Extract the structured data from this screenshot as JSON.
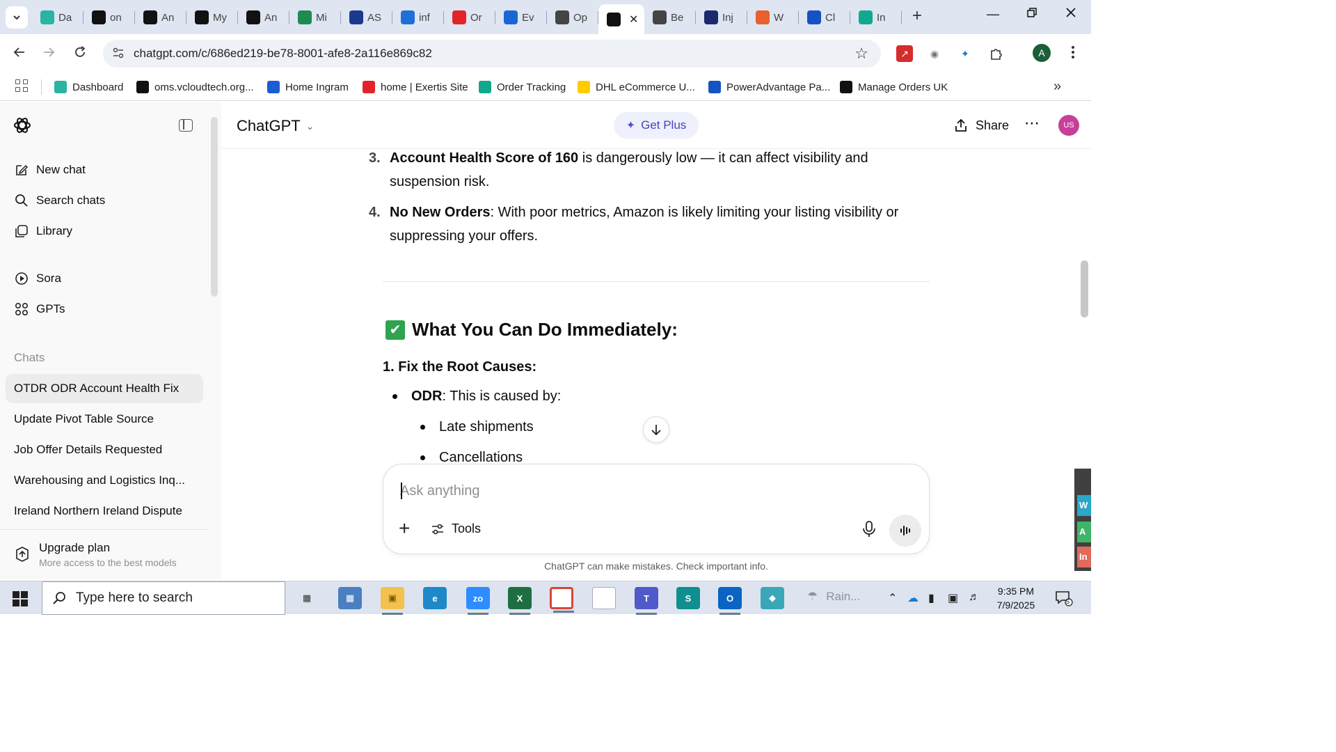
{
  "browser": {
    "tabs": [
      {
        "label": "Da",
        "fav_color": "#2bb3a4",
        "fav_icon": "dashboard-icon"
      },
      {
        "label": "on",
        "fav_color": "#111111",
        "fav_icon": "triangle-icon"
      },
      {
        "label": "An",
        "fav_color": "#111111",
        "fav_icon": "amazon-icon"
      },
      {
        "label": "My",
        "fav_color": "#111111",
        "fav_icon": "amazon-icon"
      },
      {
        "label": "An",
        "fav_color": "#111111",
        "fav_icon": "amazon-icon"
      },
      {
        "label": "Mi",
        "fav_color": "#1f8a52",
        "fav_icon": "leaf-icon"
      },
      {
        "label": "AS",
        "fav_color": "#1a3a8c",
        "fav_icon": "arrow-icon"
      },
      {
        "label": "inf",
        "fav_color": "#1e6fd9",
        "fav_icon": "infinity-icon"
      },
      {
        "label": "Or",
        "fav_color": "#e0242a",
        "fav_icon": "exertis-icon"
      },
      {
        "label": "Ev",
        "fav_color": "#1967d2",
        "fav_icon": "e-icon"
      },
      {
        "label": "Op",
        "fav_color": "#444444",
        "fav_icon": "openai-icon"
      },
      {
        "label": "",
        "fav_color": "#111111",
        "fav_icon": "openai-icon",
        "active": true
      },
      {
        "label": "Be",
        "fav_color": "#444444",
        "fav_icon": "bulb-icon"
      },
      {
        "label": "Inj",
        "fav_color": "#1a2a6c",
        "fav_icon": "ku-icon"
      },
      {
        "label": "W",
        "fav_color": "#e8602c",
        "fav_icon": "w-icon"
      },
      {
        "label": "Cl",
        "fav_color": "#1552c4",
        "fav_icon": "etn-icon"
      },
      {
        "label": "In",
        "fav_color": "#12a88f",
        "fav_icon": "c-icon"
      }
    ],
    "address": "chatgpt.com/c/686ed219-be78-8001-afe8-2a116e869c82",
    "profile_initial": "A",
    "bookmarks": [
      {
        "label": "Dashboard",
        "fav_color": "#2bb3a4"
      },
      {
        "label": "oms.vcloudtech.org...",
        "fav_color": "#111111"
      },
      {
        "label": "Home Ingram",
        "fav_color": "#1e5bd6"
      },
      {
        "label": "home | Exertis Site",
        "fav_color": "#e0242a"
      },
      {
        "label": "Order Tracking",
        "fav_color": "#12a88f"
      },
      {
        "label": "DHL eCommerce U...",
        "fav_color": "#ffcc00"
      },
      {
        "label": "PowerAdvantage Pa...",
        "fav_color": "#1552c4"
      },
      {
        "label": "Manage Orders UK",
        "fav_color": "#111111"
      }
    ]
  },
  "sidebar": {
    "nav": [
      {
        "label": "New chat",
        "icon": "compose-icon"
      },
      {
        "label": "Search chats",
        "icon": "search-icon"
      },
      {
        "label": "Library",
        "icon": "library-icon"
      },
      {
        "label": "Sora",
        "icon": "play-icon"
      },
      {
        "label": "GPTs",
        "icon": "grid-icon"
      }
    ],
    "chats_heading": "Chats",
    "chats": [
      "OTDR ODR Account Health Fix",
      "Update Pivot Table Source",
      "Job Offer Details Requested",
      "Warehousing and Logistics Inq...",
      "Ireland Northern Ireland Dispute"
    ],
    "upgrade": {
      "title": "Upgrade plan",
      "subtitle": "More access to the best models"
    }
  },
  "header": {
    "model": "ChatGPT",
    "get_plus": "Get Plus",
    "share": "Share",
    "user_initials": "US"
  },
  "conversation": {
    "items": [
      {
        "num": "3.",
        "bold": "Account Health Score of 160",
        "text": " is dangerously low — it can affect visibility and suspension risk."
      },
      {
        "num": "4.",
        "bold": "No New Orders",
        "text": ": With poor metrics, Amazon is likely limiting your listing visibility or suppressing your offers."
      }
    ],
    "heading": "What You Can Do Immediately:",
    "subheading": "1. Fix the Root Causes:",
    "bullet_bold": "ODR",
    "bullet_text": ": This is caused by:",
    "sub_bullets": [
      "Late shipments",
      "Cancellations"
    ]
  },
  "composer": {
    "placeholder": "Ask anything",
    "tools": "Tools",
    "disclaimer": "ChatGPT can make mistakes. Check important info."
  },
  "taskbar": {
    "search_placeholder": "Type here to search",
    "weather": "Rain...",
    "time": "9:35 PM",
    "date": "7/9/2025",
    "notifications": "5",
    "side_widget": [
      "W",
      "A",
      "In"
    ]
  }
}
